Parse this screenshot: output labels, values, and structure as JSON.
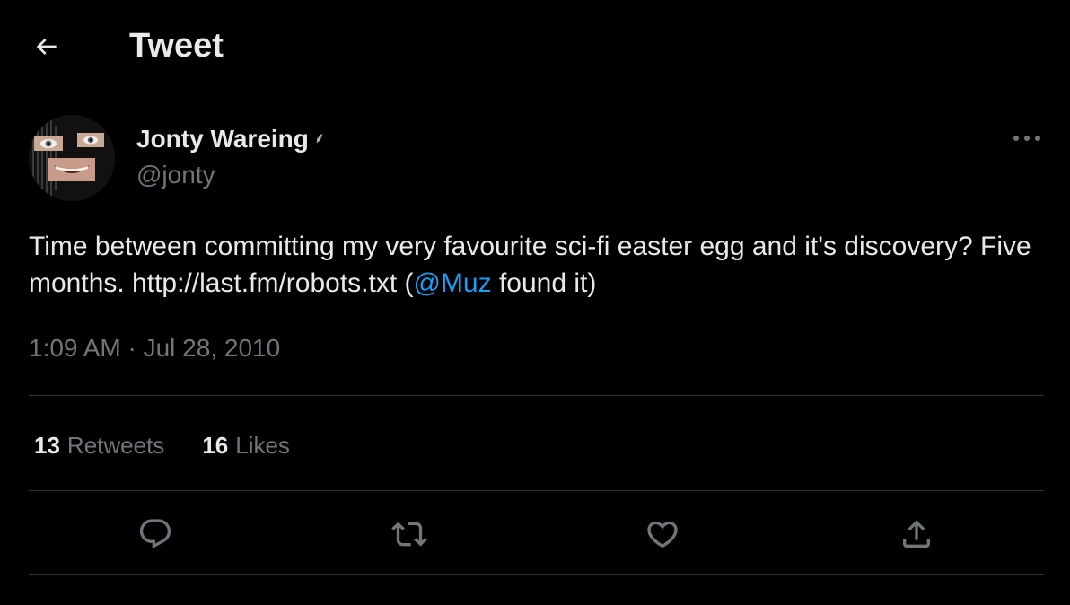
{
  "header": {
    "title": "Tweet",
    "back_icon": "arrow-left-icon"
  },
  "author": {
    "name": "Jonty Wareing",
    "name_badge": "⸙",
    "handle": "@jonty",
    "avatar_icon": "profile-avatar"
  },
  "tweet": {
    "text_before": "Time between committing my very favourite sci-fi easter egg and it's discovery? Five months. http://last.fm/robots.txt (",
    "mention": "@Muz",
    "text_after": " found it)",
    "timestamp": "1:09 AM · Jul 28, 2010"
  },
  "stats": {
    "retweets_count": "13",
    "retweets_label": "Retweets",
    "likes_count": "16",
    "likes_label": "Likes"
  },
  "actions": {
    "reply_icon": "reply-icon",
    "retweet_icon": "retweet-icon",
    "like_icon": "heart-icon",
    "share_icon": "share-icon"
  },
  "colors": {
    "background": "#000000",
    "text_primary": "#e7e9ea",
    "text_secondary": "#71767b",
    "accent": "#1d9bf0",
    "divider": "#2f3336"
  }
}
